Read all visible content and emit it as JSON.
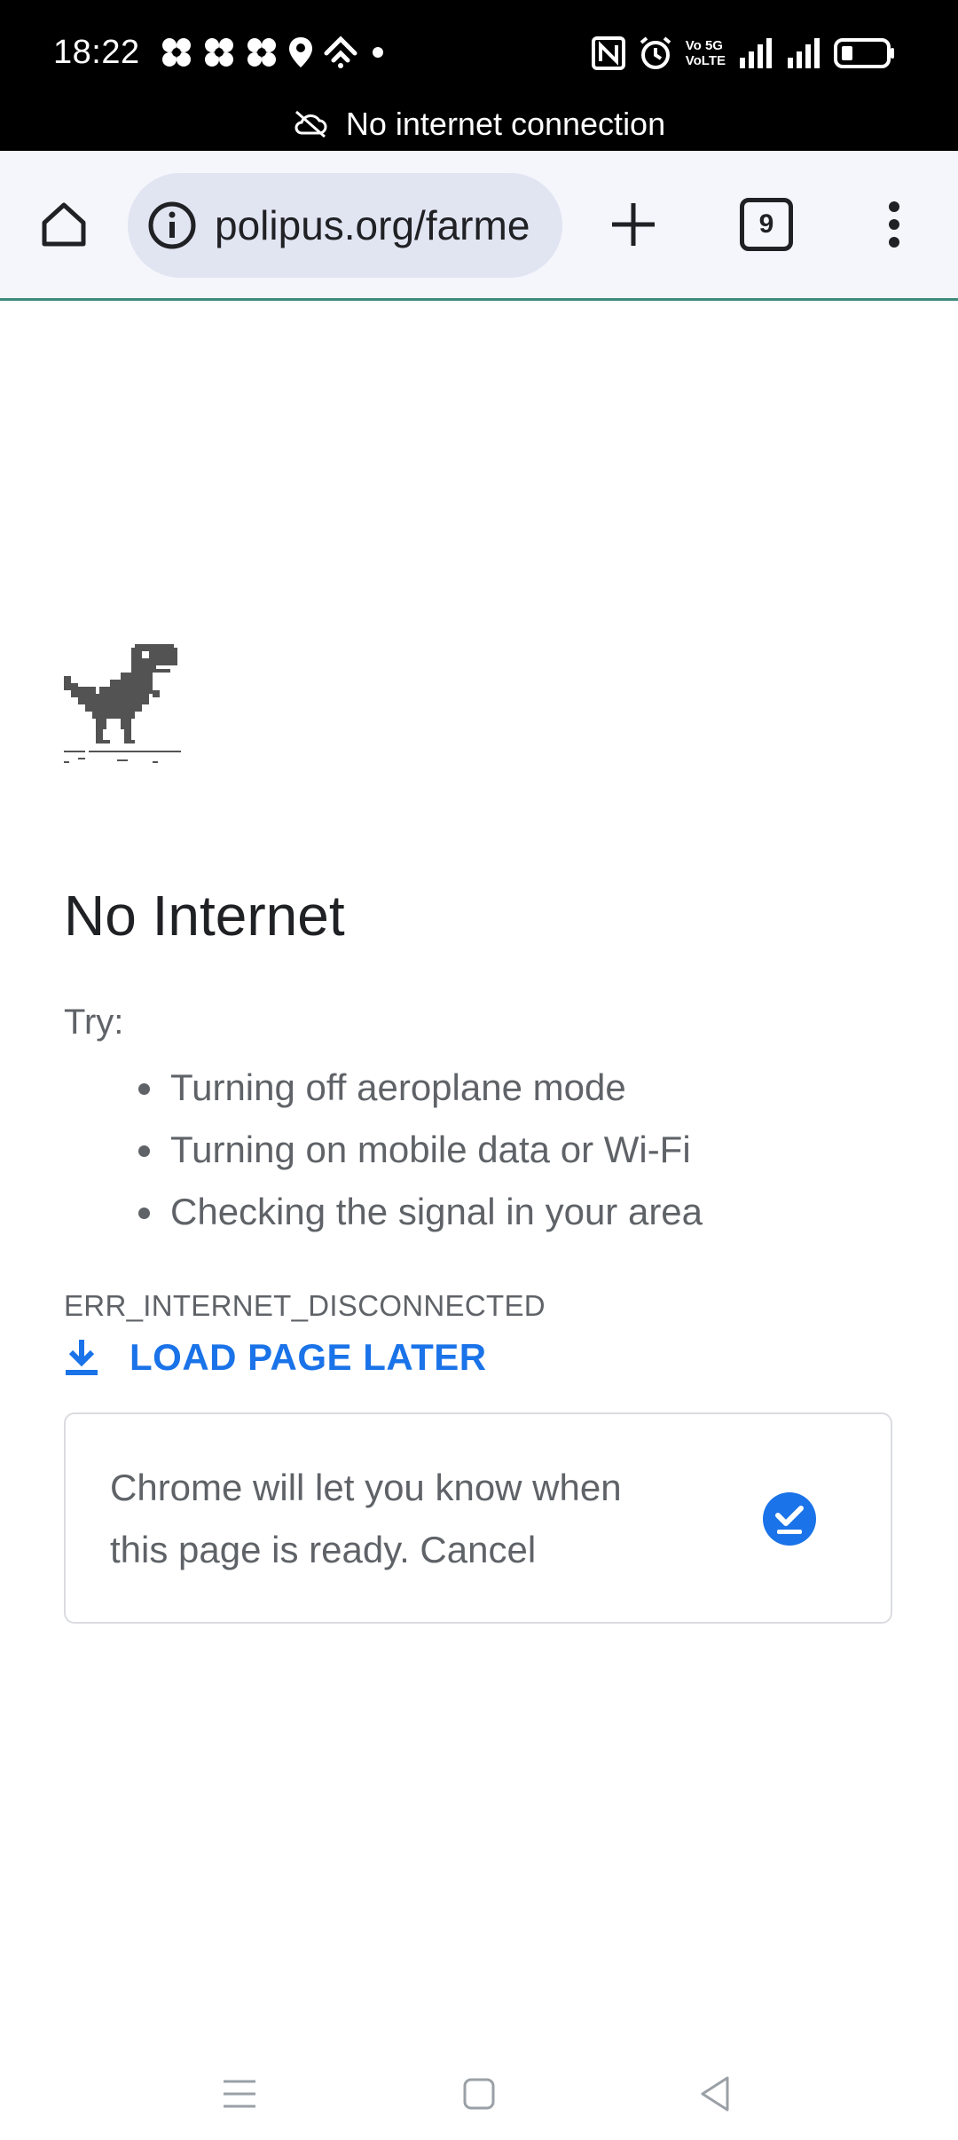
{
  "status_bar": {
    "time": "18:22",
    "offline_banner": "No internet connection",
    "icons": [
      "notification-icon",
      "notification-icon",
      "notification-icon",
      "location-icon",
      "hotspot-icon",
      "dot-icon",
      "nfc-icon",
      "alarm-icon",
      "volte-icon",
      "signal-icon",
      "signal-icon",
      "battery-icon"
    ],
    "network_label_top": "Vo 5G",
    "network_label_bottom": "VoLTE"
  },
  "toolbar": {
    "url": "polipus.org/farme",
    "tab_count": "9"
  },
  "error_page": {
    "title": "No Internet",
    "try_label": "Try:",
    "suggestions": [
      "Turning off aeroplane mode",
      "Turning on mobile data or Wi-Fi",
      "Checking the signal in your area"
    ],
    "error_code": "ERR_INTERNET_DISCONNECTED",
    "load_later_label": "LOAD PAGE LATER",
    "notify_text": "Chrome will let you know when this page is ready. Cancel"
  },
  "colors": {
    "accent": "#1a73e8",
    "status_bar_bg": "#000000",
    "toolbar_bg": "#f5f6fc",
    "omnibox_bg": "#e1e4f1",
    "progress_line": "#3c8a7c",
    "text_secondary": "#5f6368"
  }
}
